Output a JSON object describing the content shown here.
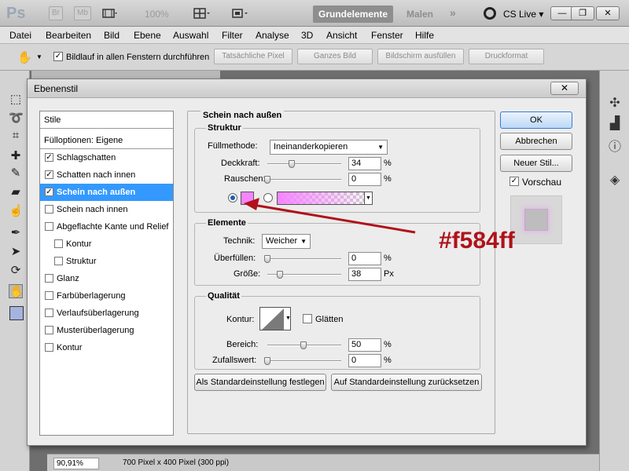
{
  "app": {
    "logo": "Ps",
    "bridge": "Br",
    "minibridge": "Mb",
    "zoom_display": "100%",
    "workspaces": {
      "active": "Grundelemente",
      "other": "Malen",
      "more": "»"
    },
    "cslive": "CS Live"
  },
  "menu": [
    "Datei",
    "Bearbeiten",
    "Bild",
    "Ebene",
    "Auswahl",
    "Filter",
    "Analyse",
    "3D",
    "Ansicht",
    "Fenster",
    "Hilfe"
  ],
  "options_bar": {
    "scroll_all_label": "Bildlauf in allen Fenstern durchführen",
    "scroll_all_checked": true,
    "buttons": [
      "Tatsächliche Pixel",
      "Ganzes Bild",
      "Bildschirm ausfüllen",
      "Druckformat"
    ]
  },
  "status": {
    "zoom": "90,91%",
    "doc_info": "700 Pixel x 400 Pixel (300 ppi)"
  },
  "dialog": {
    "title": "Ebenenstil",
    "close": "✕",
    "styles": [
      {
        "label": "Stile",
        "checkbox": false
      },
      {
        "label": "Fülloptionen: Eigene",
        "checkbox": false
      },
      {
        "label": "Schlagschatten",
        "checkbox": true,
        "checked": true
      },
      {
        "label": "Schatten nach innen",
        "checkbox": true,
        "checked": true
      },
      {
        "label": "Schein nach außen",
        "checkbox": true,
        "checked": true,
        "selected": true
      },
      {
        "label": "Schein nach innen",
        "checkbox": true,
        "checked": false
      },
      {
        "label": "Abgeflachte Kante und Relief",
        "checkbox": true,
        "checked": false
      },
      {
        "label": "Kontur",
        "checkbox": true,
        "checked": false,
        "indent": true
      },
      {
        "label": "Struktur",
        "checkbox": true,
        "checked": false,
        "indent": true
      },
      {
        "label": "Glanz",
        "checkbox": true,
        "checked": false
      },
      {
        "label": "Farbüberlagerung",
        "checkbox": true,
        "checked": false
      },
      {
        "label": "Verlaufsüberlagerung",
        "checkbox": true,
        "checked": false
      },
      {
        "label": "Musterüberlagerung",
        "checkbox": true,
        "checked": false
      },
      {
        "label": "Kontur",
        "checkbox": true,
        "checked": false
      }
    ],
    "section_title": "Schein nach außen",
    "struktur": {
      "title": "Struktur",
      "blend_label": "Füllmethode:",
      "blend_value": "Ineinanderkopieren",
      "opacity_label": "Deckkraft:",
      "opacity_value": "34",
      "opacity_unit": "%",
      "noise_label": "Rauschen:",
      "noise_value": "0",
      "noise_unit": "%",
      "glow_color": "#f584ff"
    },
    "elemente": {
      "title": "Elemente",
      "technique_label": "Technik:",
      "technique_value": "Weicher",
      "spread_label": "Überfüllen:",
      "spread_value": "0",
      "spread_unit": "%",
      "size_label": "Größe:",
      "size_value": "38",
      "size_unit": "Px"
    },
    "qualitaet": {
      "title": "Qualität",
      "contour_label": "Kontur:",
      "antialias_label": "Glätten",
      "antialias_checked": false,
      "range_label": "Bereich:",
      "range_value": "50",
      "range_unit": "%",
      "jitter_label": "Zufallswert:",
      "jitter_value": "0",
      "jitter_unit": "%"
    },
    "buttons": {
      "set_default": "Als Standardeinstellung festlegen",
      "reset_default": "Auf Standardeinstellung zurücksetzen",
      "ok": "OK",
      "cancel": "Abbrechen",
      "new_style": "Neuer Stil...",
      "preview_label": "Vorschau",
      "preview_checked": true
    }
  },
  "annotation": {
    "text": "#f584ff",
    "color": "#b0121a"
  }
}
